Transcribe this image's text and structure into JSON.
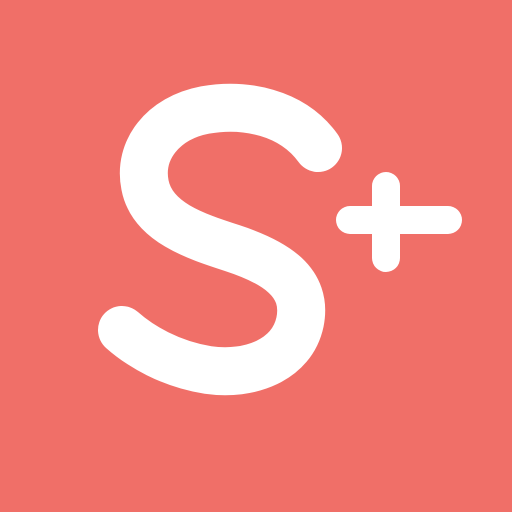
{
  "logo": {
    "letter": "S",
    "symbol": "+",
    "background_color": "#F06F68",
    "glyph_color": "#FFFFFF",
    "icon_name": "s-plus-logo-icon"
  }
}
